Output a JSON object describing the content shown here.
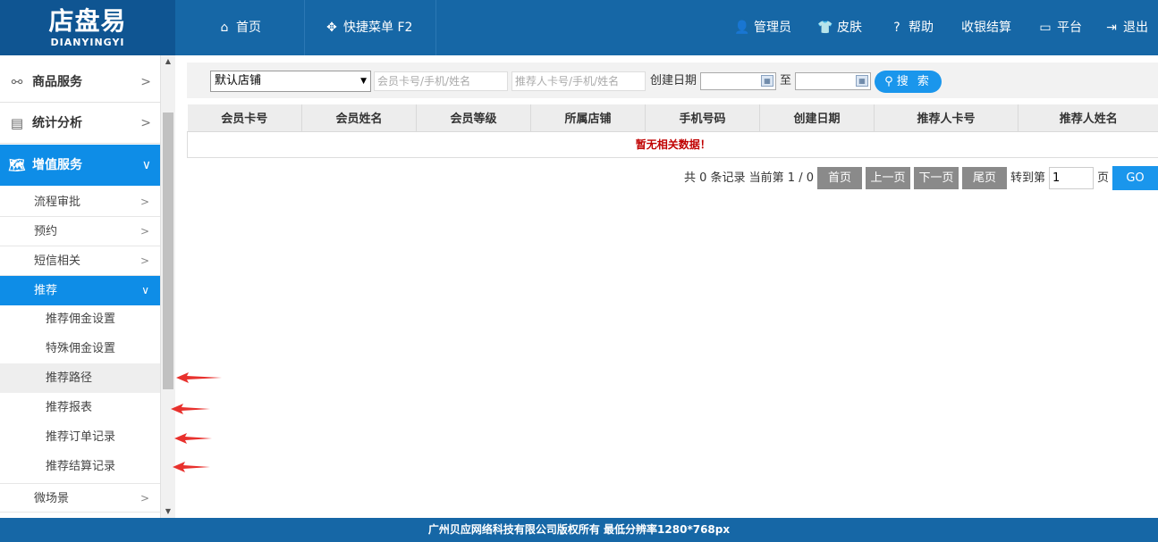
{
  "logo": {
    "line1": "店盘易",
    "line2": "DIANYINGYI"
  },
  "header": {
    "home": "首页",
    "quick_menu": "快捷菜单 F2",
    "admin": "管理员",
    "skin": "皮肤",
    "help": "帮助",
    "cashier": "收银结算",
    "platform": "平台",
    "logout": "退出"
  },
  "sidebar": {
    "sections": [
      {
        "label": "商品服务",
        "icon": "link-icon"
      },
      {
        "label": "统计分析",
        "icon": "chart-icon"
      },
      {
        "label": "增值服务",
        "icon": "map-icon"
      }
    ],
    "sub": [
      "流程审批",
      "预约",
      "短信相关",
      "推荐"
    ],
    "children": [
      "推荐佣金设置",
      "特殊佣金设置",
      "推荐路径",
      "推荐报表",
      "推荐订单记录",
      "推荐结算记录"
    ],
    "after": [
      "微场景"
    ]
  },
  "search": {
    "store_select": "默认店铺",
    "member_placeholder": "会员卡号/手机/姓名",
    "referrer_placeholder": "推荐人卡号/手机/姓名",
    "created_label": "创建日期",
    "to_label": "至",
    "button": "搜 索"
  },
  "table": {
    "columns": [
      "会员卡号",
      "会员姓名",
      "会员等级",
      "所属店铺",
      "手机号码",
      "创建日期",
      "推荐人卡号",
      "推荐人姓名"
    ],
    "empty_text": "暂无相关数据！"
  },
  "pager": {
    "summary": "共 0 条记录 当前第 1 / 0",
    "first": "首页",
    "prev": "上一页",
    "next": "下一页",
    "last": "尾页",
    "goto_label": "转到第",
    "page_value": "1",
    "page_unit": "页",
    "go": "GO"
  },
  "footer": {
    "text": "广州贝应网络科技有限公司版权所有 最低分辨率1280*768px"
  },
  "colors": {
    "header": "#1667a6",
    "accent": "#0e8de7",
    "arrow": "#e8312d"
  }
}
